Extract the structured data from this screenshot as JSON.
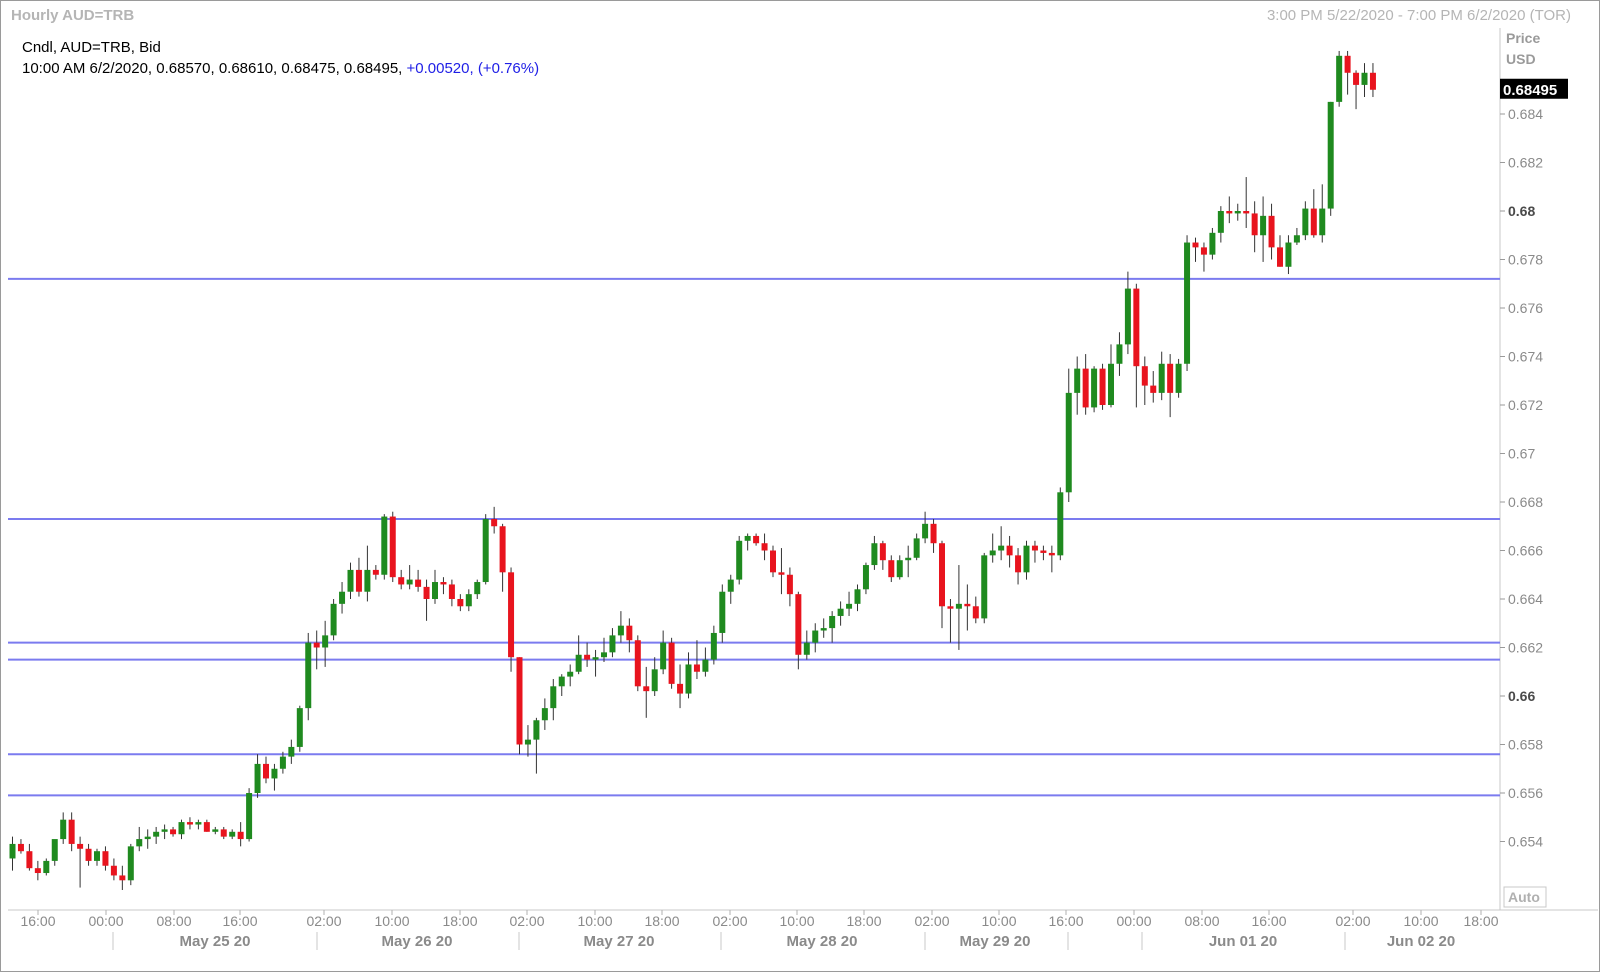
{
  "window": {
    "title": "Hourly AUD=TRB",
    "range": "3:00 PM 5/22/2020 - 7:00 PM 6/2/2020 (TOR)"
  },
  "info": {
    "line1": "Cndl, AUD=TRB, Bid",
    "line2_prefix": "10:00 AM 6/2/2020, 0.68570, 0.68610, 0.68475, 0.68495,",
    "change": "+0.00520, (+0.76%)"
  },
  "axis": {
    "price_label": "Price",
    "currency_label": "USD",
    "last_price": "0.68495",
    "auto_label": "Auto"
  },
  "colors": {
    "up": "#1f8a1f",
    "down": "#e8141e",
    "level_line": "#7b7bef",
    "last_box": "#000000"
  },
  "chart_data": {
    "type": "candlestick",
    "ylim": [
      0.6523,
      0.6871
    ],
    "yticks": [
      "0.684",
      "0.682",
      "0.68",
      "0.678",
      "0.676",
      "0.674",
      "0.672",
      "0.67",
      "0.668",
      "0.666",
      "0.664",
      "0.662",
      "0.66",
      "0.658",
      "0.656",
      "0.654"
    ],
    "bold_yticks": [
      "0.68",
      "0.66"
    ],
    "x_time_labels": [
      "16:00",
      "00:00",
      "08:00",
      "16:00",
      "02:00",
      "10:00",
      "18:00",
      "02:00",
      "10:00",
      "18:00",
      "02:00",
      "10:00",
      "18:00",
      "02:00",
      "10:00",
      "16:00",
      "00:00",
      "08:00",
      "16:00",
      "02:00",
      "10:00",
      "18:00"
    ],
    "x_date_labels": [
      "May 25 20",
      "May 26 20",
      "May 27 20",
      "May 28 20",
      "May 29 20",
      "Jun 01 20",
      "Jun 02 20"
    ],
    "horizontal_levels": [
      0.6772,
      0.6673,
      0.6622,
      0.6615,
      0.6576,
      0.6559
    ],
    "candles": [
      [
        0.6533,
        0.6542,
        0.6528,
        0.6539
      ],
      [
        0.6539,
        0.6541,
        0.6535,
        0.6536
      ],
      [
        0.6536,
        0.6539,
        0.6528,
        0.6529
      ],
      [
        0.6529,
        0.6532,
        0.6524,
        0.6527
      ],
      [
        0.6527,
        0.6533,
        0.6526,
        0.6532
      ],
      [
        0.6532,
        0.654,
        0.653,
        0.6541
      ],
      [
        0.6541,
        0.6552,
        0.6539,
        0.6549
      ],
      [
        0.6549,
        0.6552,
        0.6536,
        0.6539
      ],
      [
        0.6539,
        0.6542,
        0.6521,
        0.6537
      ],
      [
        0.6537,
        0.6539,
        0.653,
        0.6532
      ],
      [
        0.6532,
        0.6537,
        0.653,
        0.6536
      ],
      [
        0.6536,
        0.6538,
        0.6528,
        0.653
      ],
      [
        0.653,
        0.6533,
        0.6524,
        0.6526
      ],
      [
        0.6526,
        0.653,
        0.652,
        0.6524
      ],
      [
        0.6524,
        0.6539,
        0.6522,
        0.6538
      ],
      [
        0.6538,
        0.6546,
        0.6536,
        0.6541
      ],
      [
        0.6541,
        0.6545,
        0.6537,
        0.6542
      ],
      [
        0.6542,
        0.6546,
        0.6539,
        0.6544
      ],
      [
        0.6544,
        0.6547,
        0.6541,
        0.6545
      ],
      [
        0.6545,
        0.6546,
        0.6542,
        0.6543
      ],
      [
        0.6543,
        0.6549,
        0.6541,
        0.6548
      ],
      [
        0.6548,
        0.655,
        0.6545,
        0.6547
      ],
      [
        0.6547,
        0.6549,
        0.6545,
        0.6548
      ],
      [
        0.6548,
        0.6549,
        0.6544,
        0.6544
      ],
      [
        0.6544,
        0.6546,
        0.6543,
        0.6545
      ],
      [
        0.6545,
        0.6546,
        0.6541,
        0.6542
      ],
      [
        0.6542,
        0.6545,
        0.6541,
        0.6544
      ],
      [
        0.6544,
        0.6548,
        0.6538,
        0.6541
      ],
      [
        0.6541,
        0.6562,
        0.654,
        0.656
      ],
      [
        0.656,
        0.6576,
        0.6558,
        0.6572
      ],
      [
        0.6572,
        0.6575,
        0.6564,
        0.6566
      ],
      [
        0.6566,
        0.6572,
        0.6561,
        0.657
      ],
      [
        0.657,
        0.6577,
        0.6568,
        0.6575
      ],
      [
        0.6575,
        0.6582,
        0.6572,
        0.6579
      ],
      [
        0.6579,
        0.6596,
        0.6577,
        0.6595
      ],
      [
        0.6595,
        0.6626,
        0.659,
        0.6622
      ],
      [
        0.6622,
        0.6627,
        0.6611,
        0.662
      ],
      [
        0.662,
        0.6631,
        0.6612,
        0.6625
      ],
      [
        0.6625,
        0.664,
        0.6623,
        0.6638
      ],
      [
        0.6638,
        0.6647,
        0.6634,
        0.6643
      ],
      [
        0.6643,
        0.6655,
        0.664,
        0.6652
      ],
      [
        0.6652,
        0.6657,
        0.6641,
        0.6643
      ],
      [
        0.6643,
        0.6662,
        0.6639,
        0.6652
      ],
      [
        0.6652,
        0.6654,
        0.6648,
        0.665
      ],
      [
        0.665,
        0.6675,
        0.6648,
        0.6674
      ],
      [
        0.6674,
        0.6676,
        0.6647,
        0.6649
      ],
      [
        0.6649,
        0.6652,
        0.6644,
        0.6646
      ],
      [
        0.6646,
        0.6654,
        0.6644,
        0.6648
      ],
      [
        0.6648,
        0.6652,
        0.6643,
        0.6645
      ],
      [
        0.6645,
        0.6648,
        0.6631,
        0.664
      ],
      [
        0.664,
        0.6652,
        0.6638,
        0.6647
      ],
      [
        0.6647,
        0.6649,
        0.6642,
        0.6646
      ],
      [
        0.6646,
        0.6648,
        0.6637,
        0.664
      ],
      [
        0.664,
        0.6642,
        0.6635,
        0.6637
      ],
      [
        0.6637,
        0.6644,
        0.6635,
        0.6642
      ],
      [
        0.6642,
        0.6648,
        0.664,
        0.6647
      ],
      [
        0.6647,
        0.6675,
        0.6646,
        0.6673
      ],
      [
        0.6673,
        0.6678,
        0.6667,
        0.667
      ],
      [
        0.667,
        0.6671,
        0.6643,
        0.6651
      ],
      [
        0.6651,
        0.6653,
        0.661,
        0.6616
      ],
      [
        0.6616,
        0.6616,
        0.6576,
        0.658
      ],
      [
        0.658,
        0.6588,
        0.6575,
        0.6582
      ],
      [
        0.6582,
        0.6591,
        0.6568,
        0.659
      ],
      [
        0.659,
        0.6599,
        0.6586,
        0.6595
      ],
      [
        0.6595,
        0.6607,
        0.659,
        0.6604
      ],
      [
        0.6604,
        0.6609,
        0.66,
        0.6608
      ],
      [
        0.6608,
        0.6613,
        0.6604,
        0.661
      ],
      [
        0.661,
        0.6625,
        0.6609,
        0.6617
      ],
      [
        0.6617,
        0.6622,
        0.6612,
        0.6615
      ],
      [
        0.6615,
        0.6619,
        0.6608,
        0.6616
      ],
      [
        0.6616,
        0.6624,
        0.6614,
        0.6618
      ],
      [
        0.6618,
        0.6628,
        0.6616,
        0.6625
      ],
      [
        0.6625,
        0.6635,
        0.6622,
        0.6629
      ],
      [
        0.6629,
        0.6632,
        0.6618,
        0.6623
      ],
      [
        0.6623,
        0.6625,
        0.6602,
        0.6604
      ],
      [
        0.6604,
        0.6612,
        0.6591,
        0.6602
      ],
      [
        0.6602,
        0.6616,
        0.66,
        0.6611
      ],
      [
        0.6611,
        0.6627,
        0.6609,
        0.6622
      ],
      [
        0.6622,
        0.6624,
        0.6603,
        0.6605
      ],
      [
        0.6605,
        0.6613,
        0.6595,
        0.6601
      ],
      [
        0.6601,
        0.6618,
        0.6599,
        0.6613
      ],
      [
        0.6613,
        0.6623,
        0.6607,
        0.661
      ],
      [
        0.661,
        0.662,
        0.6608,
        0.6615
      ],
      [
        0.6615,
        0.6629,
        0.6613,
        0.6626
      ],
      [
        0.6626,
        0.6646,
        0.6622,
        0.6643
      ],
      [
        0.6643,
        0.665,
        0.6638,
        0.6648
      ],
      [
        0.6648,
        0.6666,
        0.6646,
        0.6664
      ],
      [
        0.6664,
        0.6667,
        0.666,
        0.6666
      ],
      [
        0.6666,
        0.6667,
        0.6662,
        0.6663
      ],
      [
        0.6663,
        0.6667,
        0.6656,
        0.666
      ],
      [
        0.666,
        0.6662,
        0.6649,
        0.6651
      ],
      [
        0.6651,
        0.6661,
        0.6642,
        0.665
      ],
      [
        0.665,
        0.6653,
        0.6637,
        0.6642
      ],
      [
        0.6642,
        0.6643,
        0.6611,
        0.6617
      ],
      [
        0.6617,
        0.6627,
        0.6615,
        0.6622
      ],
      [
        0.6622,
        0.663,
        0.6618,
        0.6627
      ],
      [
        0.6627,
        0.6632,
        0.6624,
        0.6628
      ],
      [
        0.6628,
        0.6635,
        0.6622,
        0.6633
      ],
      [
        0.6633,
        0.6639,
        0.6629,
        0.6636
      ],
      [
        0.6636,
        0.6643,
        0.6633,
        0.6638
      ],
      [
        0.6638,
        0.6646,
        0.6635,
        0.6644
      ],
      [
        0.6644,
        0.6655,
        0.6642,
        0.6654
      ],
      [
        0.6654,
        0.6666,
        0.6652,
        0.6663
      ],
      [
        0.6663,
        0.6664,
        0.6652,
        0.6656
      ],
      [
        0.6656,
        0.6658,
        0.6647,
        0.6649
      ],
      [
        0.6649,
        0.6658,
        0.6648,
        0.6656
      ],
      [
        0.6656,
        0.6662,
        0.6649,
        0.6657
      ],
      [
        0.6657,
        0.6667,
        0.6656,
        0.6665
      ],
      [
        0.6665,
        0.6676,
        0.6663,
        0.6671
      ],
      [
        0.6671,
        0.6673,
        0.6659,
        0.6663
      ],
      [
        0.6663,
        0.6664,
        0.6628,
        0.6637
      ],
      [
        0.6637,
        0.664,
        0.6622,
        0.6636
      ],
      [
        0.6636,
        0.6654,
        0.6619,
        0.6638
      ],
      [
        0.6638,
        0.6646,
        0.6627,
        0.6637
      ],
      [
        0.6637,
        0.6641,
        0.663,
        0.6632
      ],
      [
        0.6632,
        0.6659,
        0.663,
        0.6658
      ],
      [
        0.6658,
        0.6667,
        0.6655,
        0.666
      ],
      [
        0.666,
        0.667,
        0.6656,
        0.6662
      ],
      [
        0.6662,
        0.6666,
        0.6653,
        0.6658
      ],
      [
        0.6658,
        0.6661,
        0.6646,
        0.6651
      ],
      [
        0.6651,
        0.6664,
        0.6648,
        0.6662
      ],
      [
        0.6662,
        0.6664,
        0.6655,
        0.666
      ],
      [
        0.666,
        0.6662,
        0.6656,
        0.6659
      ],
      [
        0.6659,
        0.6662,
        0.6651,
        0.6658
      ],
      [
        0.6658,
        0.6686,
        0.6656,
        0.6684
      ],
      [
        0.6684,
        0.6735,
        0.668,
        0.6725
      ],
      [
        0.6725,
        0.674,
        0.6716,
        0.6735
      ],
      [
        0.6735,
        0.6741,
        0.6716,
        0.6719
      ],
      [
        0.6719,
        0.6736,
        0.6717,
        0.6735
      ],
      [
        0.6735,
        0.6737,
        0.6718,
        0.672
      ],
      [
        0.672,
        0.6745,
        0.6719,
        0.6737
      ],
      [
        0.6737,
        0.675,
        0.6732,
        0.6745
      ],
      [
        0.6745,
        0.6775,
        0.6741,
        0.6768
      ],
      [
        0.6768,
        0.677,
        0.6719,
        0.6736
      ],
      [
        0.6736,
        0.674,
        0.672,
        0.6728
      ],
      [
        0.6728,
        0.6734,
        0.6721,
        0.6725
      ],
      [
        0.6725,
        0.6742,
        0.6722,
        0.6737
      ],
      [
        0.6737,
        0.6741,
        0.6715,
        0.6725
      ],
      [
        0.6725,
        0.6739,
        0.6723,
        0.6737
      ],
      [
        0.6737,
        0.679,
        0.6734,
        0.6787
      ],
      [
        0.6787,
        0.6789,
        0.6779,
        0.6785
      ],
      [
        0.6785,
        0.6787,
        0.6775,
        0.6782
      ],
      [
        0.6782,
        0.6793,
        0.678,
        0.6791
      ],
      [
        0.6791,
        0.6802,
        0.6787,
        0.68
      ],
      [
        0.68,
        0.6806,
        0.6795,
        0.6799
      ],
      [
        0.6799,
        0.6803,
        0.6796,
        0.68
      ],
      [
        0.68,
        0.6814,
        0.6793,
        0.6799
      ],
      [
        0.6799,
        0.6804,
        0.6783,
        0.679
      ],
      [
        0.679,
        0.6806,
        0.6779,
        0.6798
      ],
      [
        0.6798,
        0.6803,
        0.678,
        0.6785
      ],
      [
        0.6785,
        0.679,
        0.6777,
        0.6777
      ],
      [
        0.6777,
        0.679,
        0.6774,
        0.6787
      ],
      [
        0.6787,
        0.6793,
        0.6786,
        0.679
      ],
      [
        0.679,
        0.6804,
        0.6788,
        0.6801
      ],
      [
        0.6801,
        0.6809,
        0.6789,
        0.679
      ],
      [
        0.679,
        0.6811,
        0.6787,
        0.6801
      ],
      [
        0.6801,
        0.6845,
        0.6798,
        0.6845
      ],
      [
        0.6845,
        0.6866,
        0.6843,
        0.6864
      ],
      [
        0.6864,
        0.6866,
        0.6848,
        0.6857
      ],
      [
        0.6857,
        0.6858,
        0.6842,
        0.6852
      ],
      [
        0.6852,
        0.6861,
        0.6847,
        0.6857
      ],
      [
        0.6857,
        0.6861,
        0.6847,
        0.685
      ]
    ]
  }
}
